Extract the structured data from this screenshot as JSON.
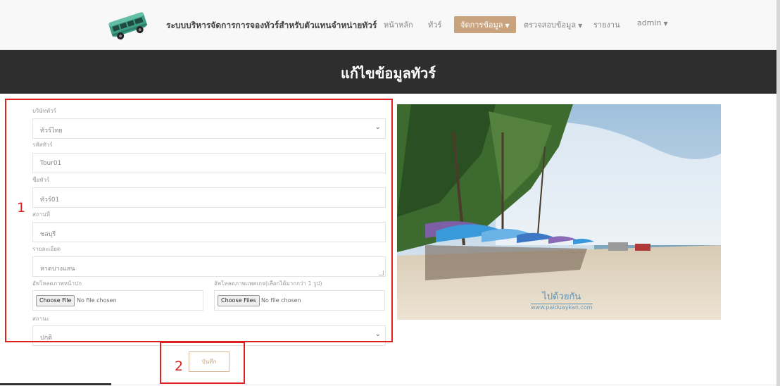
{
  "nav": {
    "brand": "ระบบบริหารจัดการการจองทัวร์สำหรับตัวแทนจำหน่ายทัวร์",
    "home": "หน้าหลัก",
    "tours": "ทัวร์",
    "manage": "จัดการข้อมูล",
    "check": "ตรวจสอบข้อมูล",
    "report": "รายงาน",
    "user": "admin"
  },
  "page_title": "แก้ไขข้อมูลทัวร์",
  "form": {
    "company_label": "บริษัททัวร์",
    "company_value": "ทัวร์ไทย",
    "code_label": "รหัสทัวร์",
    "code_value": "Tour01",
    "name_label": "ชื่อทัวร์",
    "name_value": "ทัวร์01",
    "place_label": "สถานที่",
    "place_value": "ชลบุรี",
    "detail_label": "รายละเอียด",
    "detail_value": "หาดบางแสน",
    "cover_label": "อัพโหลดภาพหน้าปก",
    "cover_button": "Choose File",
    "cover_status": "No file chosen",
    "gallery_label": "อัพโหลดภาพแพคเกจ(เลือกได้มากกว่า 1 รูป)",
    "gallery_button": "Choose Files",
    "gallery_status": "No file chosen",
    "status_label": "สถานะ",
    "status_value": "ปกติ",
    "save_label": "บันทึก"
  },
  "annotations": {
    "form_number": "1",
    "save_number": "2"
  },
  "photo": {
    "watermark_text": "ไปด้วยกัน",
    "watermark_url": "www.paiduaykan.com"
  },
  "colors": {
    "accent": "#c9a27e",
    "hero_bg": "#2e2e2e",
    "annotation": "#e01f1f"
  }
}
